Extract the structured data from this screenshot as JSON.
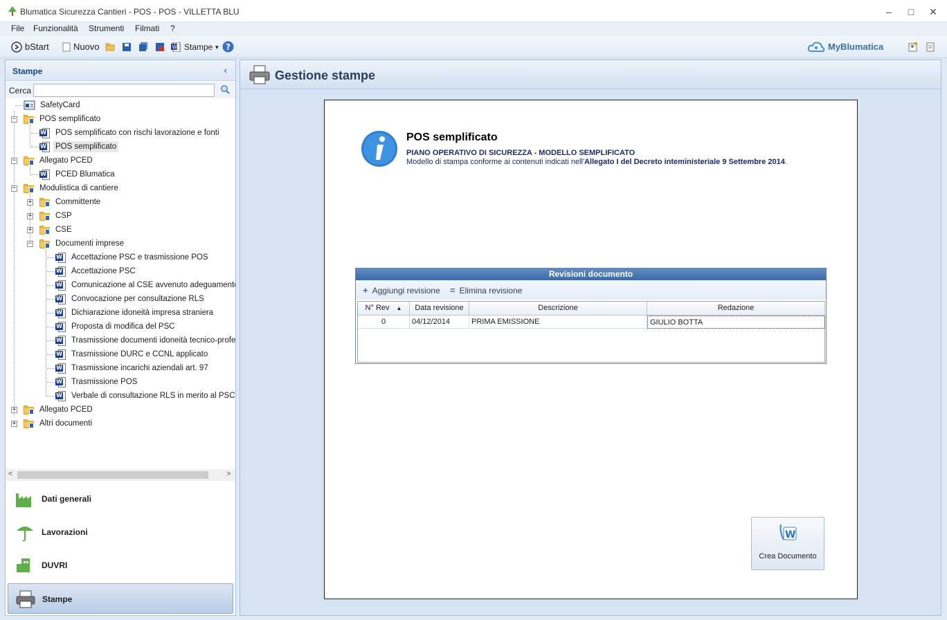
{
  "window": {
    "title": "Blumatica Sicurezza Cantieri - POS - POS - VILLETTA BLU",
    "minimize": "–",
    "maximize": "□",
    "close": "✕"
  },
  "menu": {
    "items": [
      "File",
      "Funzionalità",
      "Strumenti",
      "Filmati",
      "?"
    ]
  },
  "toolbar": {
    "bstart": "bStart",
    "nuovo": "Nuovo",
    "stampe": "Stampe",
    "mybrand": "MyBlumatica"
  },
  "sidebar": {
    "header": "Stampe",
    "search_label": "Cerca",
    "search_value": "",
    "tree": [
      {
        "label": "SafetyCard"
      },
      {
        "label": "POS semplificato"
      },
      {
        "label": "POS semplificato con rischi lavorazione e fonti"
      },
      {
        "label": "POS semplificato"
      },
      {
        "label": "Allegato PCED"
      },
      {
        "label": "PCED Blumatica"
      },
      {
        "label": "Modulistica di cantiere"
      },
      {
        "label": "Committente"
      },
      {
        "label": "CSP"
      },
      {
        "label": "CSE"
      },
      {
        "label": "Documenti imprese"
      },
      {
        "label": "Accettazione PSC e trasmissione POS"
      },
      {
        "label": "Accettazione PSC"
      },
      {
        "label": "Comunicazione al CSE avvenuto adeguamento"
      },
      {
        "label": "Convocazione per consultazione RLS"
      },
      {
        "label": "Dichiarazione idoneità impresa straniera"
      },
      {
        "label": "Proposta di modifica del PSC"
      },
      {
        "label": "Trasmissione documenti idoneità tecnico-professio"
      },
      {
        "label": "Trasmissione DURC e CCNL applicato"
      },
      {
        "label": "Trasmissione incarichi aziendali art. 97"
      },
      {
        "label": "Trasmissione POS"
      },
      {
        "label": "Verbale di consultazione RLS in merito al PSC"
      },
      {
        "label": "Allegato PCED"
      },
      {
        "label": "Altri documenti"
      }
    ],
    "nav": [
      "Dati generali",
      "Lavorazioni",
      "DUVRI",
      "Stampe"
    ]
  },
  "main": {
    "header": "Gestione stampe",
    "doc_title": "POS semplificato",
    "doc_subtitle": "PIANO OPERATIVO DI SICUREZZA - MODELLO  SEMPLIFICATO",
    "doc_desc_prefix": "Modello di stampa conforme ai contenuti indicati nell'",
    "doc_desc_bold": "Allegato I del Decreto inteministeriale 9 Settembre 2014",
    "doc_desc_suffix": ".",
    "revisions": {
      "title": "Revisioni documento",
      "add": "Aggiungi revisione",
      "remove": "Elimina revisione",
      "columns": [
        "N° Rev",
        "Data revisione",
        "Descrizione",
        "Redazione"
      ],
      "rows": [
        [
          "0",
          "04/12/2014",
          "PRIMA EMISSIONE",
          "GIULIO BOTTA"
        ]
      ]
    },
    "create_button": "Crea Documento"
  }
}
